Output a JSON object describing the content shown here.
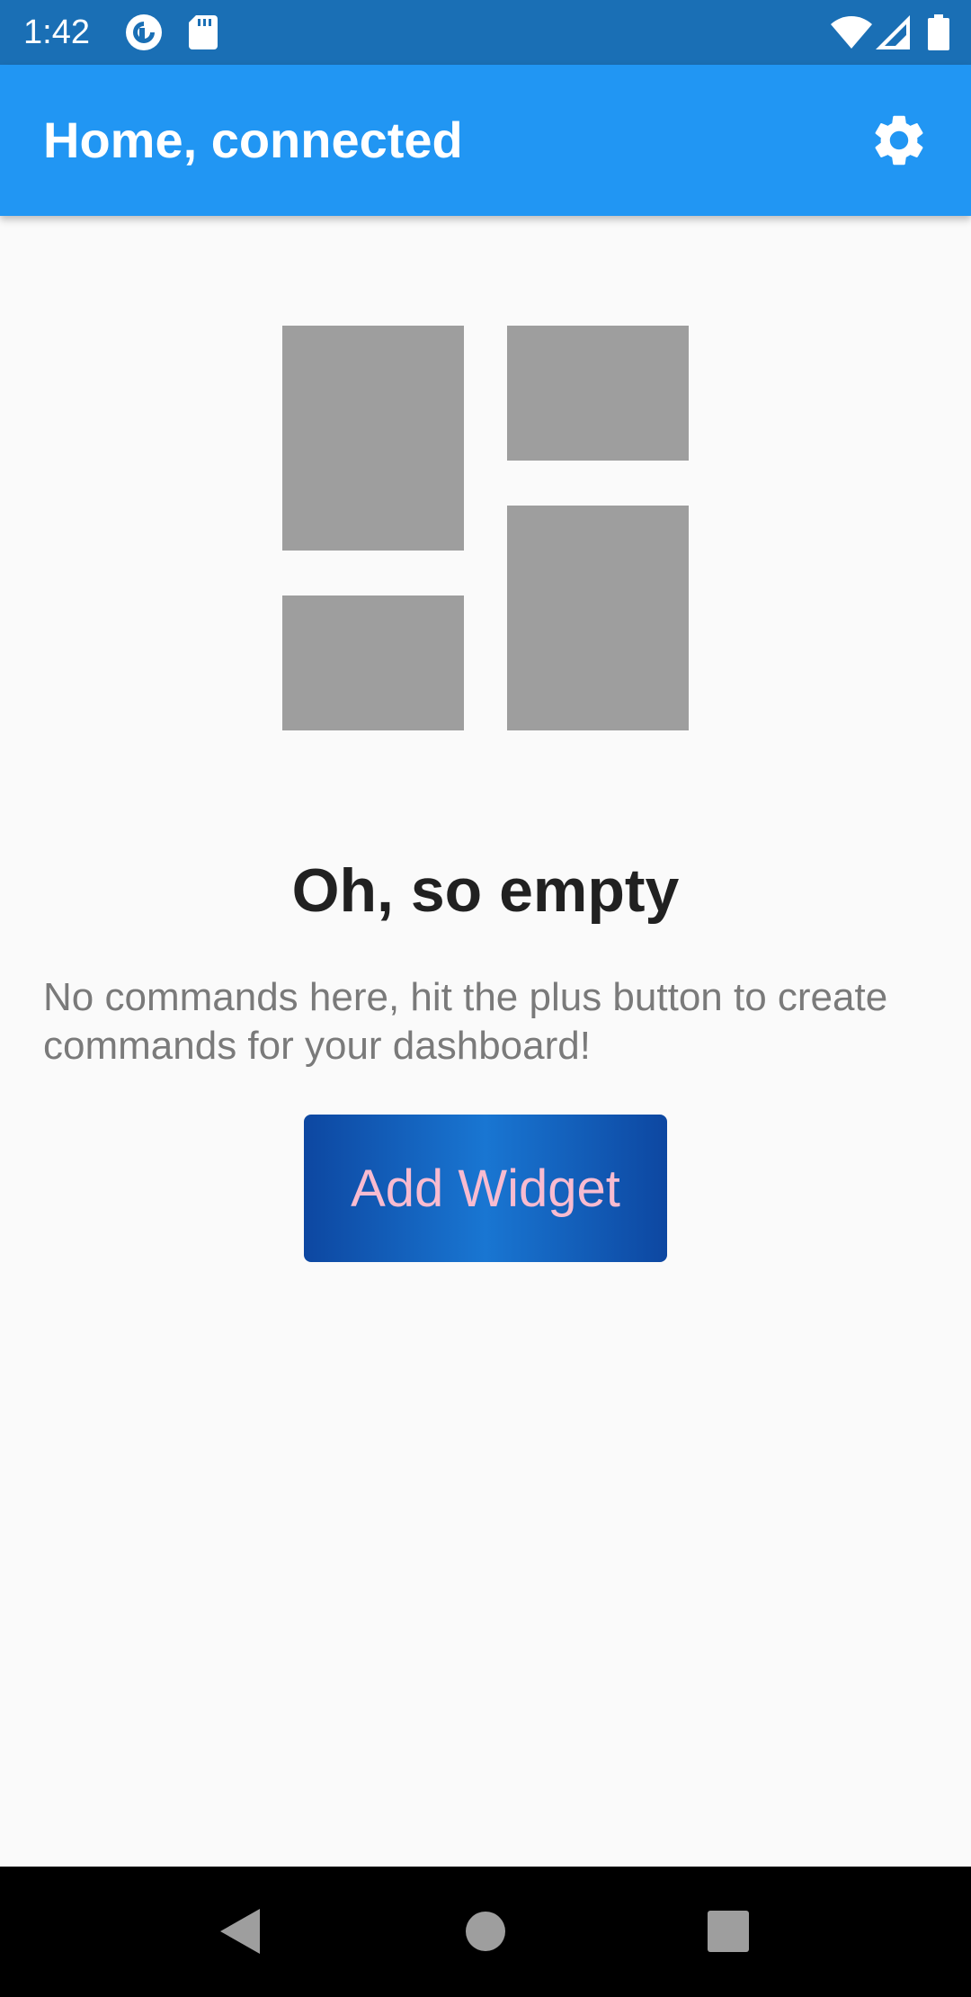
{
  "status_bar": {
    "time": "1:42",
    "icons": [
      "pocket-casts-icon",
      "sd-card-icon",
      "wifi-icon",
      "cell-signal-icon",
      "battery-icon"
    ],
    "background": "#1a6fb5"
  },
  "app_bar": {
    "title": "Home, connected",
    "action_icon": "gear-icon",
    "background": "#2196f3"
  },
  "empty_state": {
    "illustration": "dashboard-layout-icon",
    "title": "Oh, so empty",
    "description": "No commands here, hit the plus button to create commands for your dashboard!",
    "button_label": "Add Widget",
    "button_colors": [
      "#0d47a1",
      "#1976d2"
    ],
    "button_text_color": "#f8bbd0"
  },
  "nav_bar": {
    "buttons": [
      "back-icon",
      "home-icon",
      "recents-icon"
    ]
  }
}
